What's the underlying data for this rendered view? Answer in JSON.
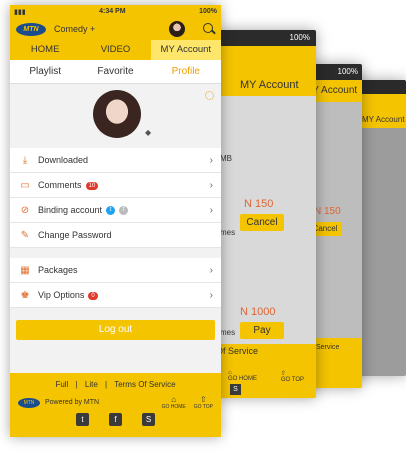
{
  "status": {
    "time": "4:34 PM",
    "battery": "100%"
  },
  "app": {
    "logo": "MTN",
    "name": "Comedy +"
  },
  "nav_tabs": [
    "HOME",
    "VIDEO",
    "MY Account"
  ],
  "sub_tabs": [
    "Playlist",
    "Favorite",
    "Profile"
  ],
  "menu": [
    {
      "label": "Downloaded",
      "icon": "download-icon"
    },
    {
      "label": "Comments",
      "icon": "comment-icon",
      "count": "10"
    },
    {
      "label": "Binding account",
      "icon": "link-icon"
    },
    {
      "label": "Change Password",
      "icon": "pencil-icon"
    }
  ],
  "menu2": [
    {
      "label": "Packages",
      "icon": "calendar-icon"
    },
    {
      "label": "Vip Options",
      "icon": "vip-icon",
      "count": "0"
    }
  ],
  "logout": "Log out",
  "footer": {
    "link_full": "Full",
    "link_lite": "Lite",
    "link_terms": "Terms Of Service",
    "powered_logo": "MTN",
    "powered": "Powered by MTN",
    "go_home": "GO HOME",
    "go_top": "GO TOP"
  },
  "bg2": {
    "battery": "100%",
    "account": "MY Account",
    "price1": "N 150",
    "cancel": "Cancel",
    "price2": "N 1000",
    "pay": "Pay",
    "fragment1": "MB",
    "fragment2": "mes",
    "fragment3": "mes",
    "fragment4": "Of Service",
    "go_home": "GO HOME",
    "go_top": "GO TOP",
    "s_logo": "S"
  },
  "bg3": {
    "battery": "100%",
    "account": "MY Account",
    "price": "N 150",
    "cancel": "Cancel",
    "terms": "Service"
  },
  "bg4": {
    "battery": "100%",
    "account": "MY Account"
  },
  "colors": {
    "yellow": "#f5c400",
    "accent": "#f0a000",
    "badge": "#e03a2a"
  }
}
